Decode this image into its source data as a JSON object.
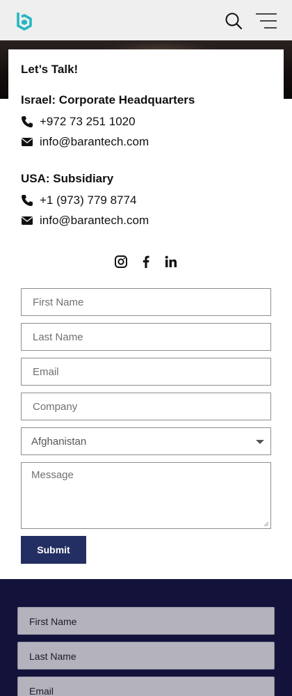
{
  "header": {
    "logo_icon": "barantech-logo-icon",
    "search_icon": "search-icon",
    "menu_icon": "hamburger-menu-icon",
    "accent_color": "#26b7c6"
  },
  "contact": {
    "heading": "Let’s Talk!",
    "offices": [
      {
        "title": "Israel: Corporate Headquarters",
        "phone": "+972 73 251 1020",
        "email": "info@barantech.com"
      },
      {
        "title": "USA: Subsidiary",
        "phone": "+1 (973) 779 8774",
        "email": "info@barantech.com"
      }
    ],
    "social_icons": [
      "instagram-icon",
      "facebook-icon",
      "linkedin-icon"
    ]
  },
  "form": {
    "first_name_placeholder": "First Name",
    "last_name_placeholder": "Last Name",
    "email_placeholder": "Email",
    "company_placeholder": "Company",
    "country_selected": "Afghanistan",
    "message_placeholder": "Message",
    "submit_label": "Submit",
    "submit_color": "#232e62"
  },
  "footer_form": {
    "first_name_placeholder": "First Name",
    "last_name_placeholder": "Last Name",
    "email_placeholder": "Email",
    "background_color": "#12123a"
  }
}
